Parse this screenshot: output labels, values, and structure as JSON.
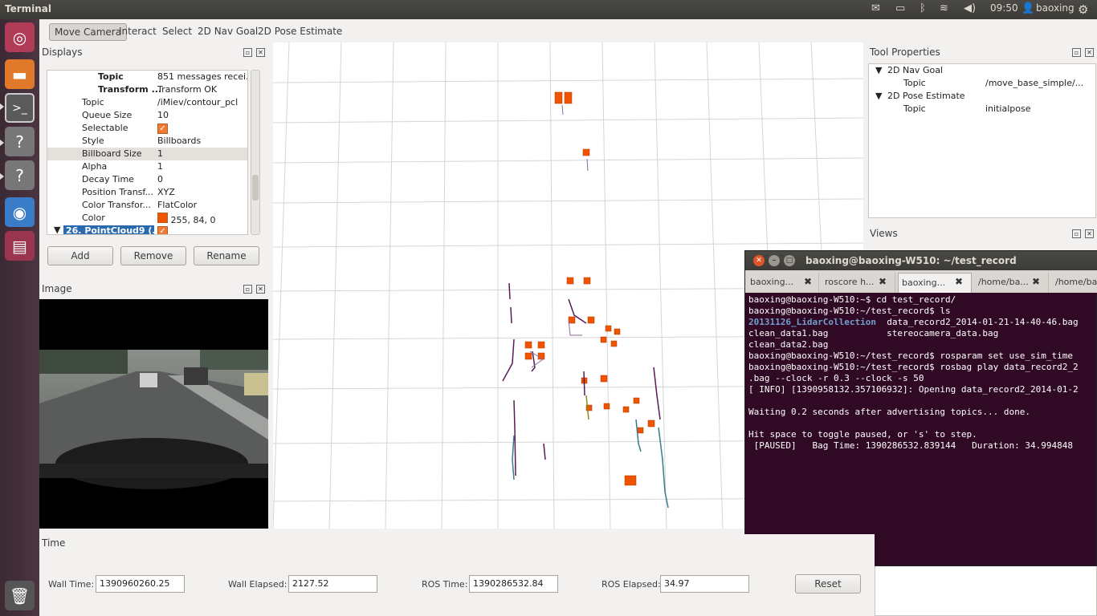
{
  "topbar": {
    "title": "Terminal",
    "clock": "09:50",
    "user": "baoxing"
  },
  "toolbar": {
    "move_camera": "Move Camera",
    "interact": "Interact",
    "select": "Select",
    "nav_goal": "2D Nav Goal",
    "pose_estimate": "2D Pose Estimate"
  },
  "displays": {
    "title": "Displays",
    "rows": [
      {
        "key": "Topic",
        "value": "851 messages recei..."
      },
      {
        "key": "Transform ...",
        "value": "Transform OK"
      },
      {
        "key": "Topic",
        "value": "/iMiev/contour_pcl"
      },
      {
        "key": "Queue Size",
        "value": "10"
      },
      {
        "key": "Selectable",
        "value": ""
      },
      {
        "key": "Style",
        "value": "Billboards"
      },
      {
        "key": "Billboard Size",
        "value": "1"
      },
      {
        "key": "Alpha",
        "value": "1"
      },
      {
        "key": "Decay Time",
        "value": "0"
      },
      {
        "key": "Position Transf...",
        "value": "XYZ"
      },
      {
        "key": "Color Transfor...",
        "value": "FlatColor"
      },
      {
        "key": "Color",
        "value": "255, 84, 0"
      },
      {
        "key": "26. PointCloud9 (...",
        "value": ""
      }
    ],
    "add": "Add",
    "remove": "Remove",
    "rename": "Rename"
  },
  "image_panel": {
    "title": "Image"
  },
  "tool_properties": {
    "title": "Tool Properties",
    "items": [
      {
        "name": "2D Nav Goal",
        "prop": "Topic",
        "value": "/move_base_simple/..."
      },
      {
        "name": "2D Pose Estimate",
        "prop": "Topic",
        "value": "initialpose"
      }
    ]
  },
  "views": {
    "title": "Views"
  },
  "terminal": {
    "title": "baoxing@baoxing-W510: ~/test_record",
    "tabs": [
      "baoxing...",
      "roscore h...",
      "baoxing...",
      "/home/ba...",
      "/home/ba..."
    ],
    "lines": [
      "baoxing@baoxing-W510:~$ cd test_record/",
      "baoxing@baoxing-W510:~/test_record$ ls",
      "20131126_LidarCollection  data_record2_2014-01-21-14-40-46.bag",
      "clean_data1.bag           stereocamera_data.bag",
      "clean_data2.bag",
      "baoxing@baoxing-W510:~/test_record$ rosparam set use_sim_time",
      "baoxing@baoxing-W510:~/test_record$ rosbag play data_record2_2",
      ".bag --clock -r 0.3 --clock -s 50",
      "[ INFO] [1390958132.357106932]: Opening data_record2_2014-01-2",
      "",
      "Waiting 0.2 seconds after advertising topics... done.",
      "",
      "Hit space to toggle paused, or 's' to step.",
      " [PAUSED]   Bag Time: 1390286532.839144   Duration: 34.994848"
    ]
  },
  "time": {
    "title": "Time",
    "wall_time_label": "Wall Time:",
    "wall_time": "1390960260.25",
    "wall_elapsed_label": "Wall Elapsed:",
    "wall_elapsed": "2127.52",
    "ros_time_label": "ROS Time:",
    "ros_time": "1390286532.84",
    "ros_elapsed_label": "ROS Elapsed:",
    "ros_elapsed": "34.97",
    "reset": "Reset"
  },
  "colors": {
    "marker": "#f05400",
    "terminal_bg": "#300a24",
    "dir_blue": "#729fcf"
  }
}
